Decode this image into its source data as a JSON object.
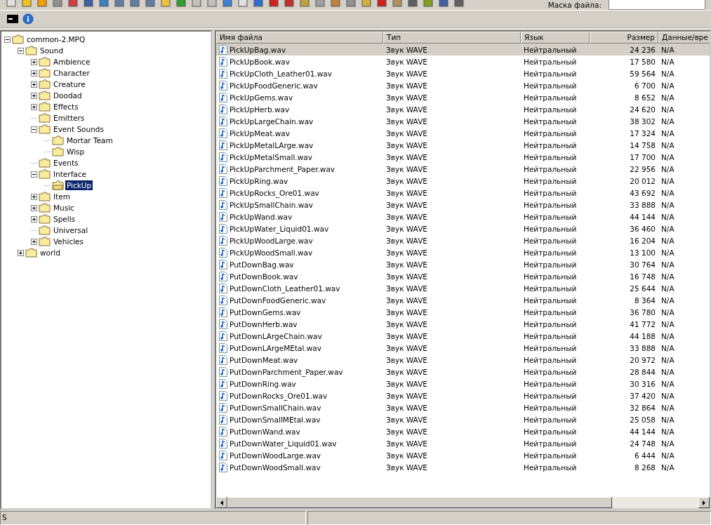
{
  "toolbar": {
    "mask_label": "Маска файла:"
  },
  "tree": [
    {
      "label": "common-2.MPQ",
      "expanded": true,
      "selected": false,
      "children": [
        {
          "label": "Sound",
          "expanded": true,
          "selected": false,
          "children": [
            {
              "label": "Ambience",
              "expanded": false,
              "selected": false
            },
            {
              "label": "Character",
              "expanded": false,
              "selected": false
            },
            {
              "label": "Creature",
              "expanded": false,
              "selected": false
            },
            {
              "label": "Doodad",
              "expanded": false,
              "selected": false
            },
            {
              "label": "Effects",
              "expanded": false,
              "selected": false
            },
            {
              "label": "Emitters",
              "selected": false
            },
            {
              "label": "Event Sounds",
              "expanded": true,
              "selected": false,
              "children": [
                {
                  "label": "Mortar Team",
                  "selected": false
                },
                {
                  "label": "Wisp",
                  "selected": false
                }
              ]
            },
            {
              "label": "Events",
              "selected": false
            },
            {
              "label": "Interface",
              "expanded": true,
              "selected": false,
              "children": [
                {
                  "label": "PickUp",
                  "selected": true
                }
              ]
            },
            {
              "label": "Item",
              "expanded": false,
              "selected": false
            },
            {
              "label": "Music",
              "expanded": false,
              "selected": false
            },
            {
              "label": "Spells",
              "expanded": false,
              "selected": false
            },
            {
              "label": "Universal",
              "selected": false
            },
            {
              "label": "Vehicles",
              "expanded": false,
              "selected": false
            }
          ]
        },
        {
          "label": "world",
          "expanded": false,
          "selected": false
        }
      ]
    }
  ],
  "table": {
    "columns": [
      "Имя файла",
      "Тип",
      "Язык",
      "Размер",
      "Данные/вре"
    ],
    "rows": [
      {
        "name": "PickUpBag.wav",
        "type": "Звук WAVE",
        "language": "Нейтральный",
        "size": "24 236",
        "data": "N/A",
        "selected": true
      },
      {
        "name": "PickUpBook.wav",
        "type": "Звук WAVE",
        "language": "Нейтральный",
        "size": "17 580",
        "data": "N/A",
        "selected": false
      },
      {
        "name": "PickUpCloth_Leather01.wav",
        "type": "Звук WAVE",
        "language": "Нейтральный",
        "size": "59 564",
        "data": "N/A",
        "selected": false
      },
      {
        "name": "PickUpFoodGeneric.wav",
        "type": "Звук WAVE",
        "language": "Нейтральный",
        "size": "6 700",
        "data": "N/A",
        "selected": false
      },
      {
        "name": "PickUpGems.wav",
        "type": "Звук WAVE",
        "language": "Нейтральный",
        "size": "8 652",
        "data": "N/A",
        "selected": false
      },
      {
        "name": "PickUpHerb.wav",
        "type": "Звук WAVE",
        "language": "Нейтральный",
        "size": "24 620",
        "data": "N/A",
        "selected": false
      },
      {
        "name": "PickUpLargeChain.wav",
        "type": "Звук WAVE",
        "language": "Нейтральный",
        "size": "38 302",
        "data": "N/A",
        "selected": false
      },
      {
        "name": "PickUpMeat.wav",
        "type": "Звук WAVE",
        "language": "Нейтральный",
        "size": "17 324",
        "data": "N/A",
        "selected": false
      },
      {
        "name": "PickUpMetalLArge.wav",
        "type": "Звук WAVE",
        "language": "Нейтральный",
        "size": "14 758",
        "data": "N/A",
        "selected": false
      },
      {
        "name": "PickUpMetalSmall.wav",
        "type": "Звук WAVE",
        "language": "Нейтральный",
        "size": "17 700",
        "data": "N/A",
        "selected": false
      },
      {
        "name": "PickUpParchment_Paper.wav",
        "type": "Звук WAVE",
        "language": "Нейтральный",
        "size": "22 956",
        "data": "N/A",
        "selected": false
      },
      {
        "name": "PickUpRing.wav",
        "type": "Звук WAVE",
        "language": "Нейтральный",
        "size": "20 012",
        "data": "N/A",
        "selected": false
      },
      {
        "name": "PickUpRocks_Ore01.wav",
        "type": "Звук WAVE",
        "language": "Нейтральный",
        "size": "43 692",
        "data": "N/A",
        "selected": false
      },
      {
        "name": "PickUpSmallChain.wav",
        "type": "Звук WAVE",
        "language": "Нейтральный",
        "size": "33 888",
        "data": "N/A",
        "selected": false
      },
      {
        "name": "PickUpWand.wav",
        "type": "Звук WAVE",
        "language": "Нейтральный",
        "size": "44 144",
        "data": "N/A",
        "selected": false
      },
      {
        "name": "PickUpWater_Liquid01.wav",
        "type": "Звук WAVE",
        "language": "Нейтральный",
        "size": "36 460",
        "data": "N/A",
        "selected": false
      },
      {
        "name": "PickUpWoodLarge.wav",
        "type": "Звук WAVE",
        "language": "Нейтральный",
        "size": "16 204",
        "data": "N/A",
        "selected": false
      },
      {
        "name": "PickUpWoodSmall.wav",
        "type": "Звук WAVE",
        "language": "Нейтральный",
        "size": "13 100",
        "data": "N/A",
        "selected": false
      },
      {
        "name": "PutDownBag.wav",
        "type": "Звук WAVE",
        "language": "Нейтральный",
        "size": "30 764",
        "data": "N/A",
        "selected": false
      },
      {
        "name": "PutDownBook.wav",
        "type": "Звук WAVE",
        "language": "Нейтральный",
        "size": "16 748",
        "data": "N/A",
        "selected": false
      },
      {
        "name": "PutDownCloth_Leather01.wav",
        "type": "Звук WAVE",
        "language": "Нейтральный",
        "size": "25 644",
        "data": "N/A",
        "selected": false
      },
      {
        "name": "PutDownFoodGeneric.wav",
        "type": "Звук WAVE",
        "language": "Нейтральный",
        "size": "8 364",
        "data": "N/A",
        "selected": false
      },
      {
        "name": "PutDownGems.wav",
        "type": "Звук WAVE",
        "language": "Нейтральный",
        "size": "36 780",
        "data": "N/A",
        "selected": false
      },
      {
        "name": "PutDownHerb.wav",
        "type": "Звук WAVE",
        "language": "Нейтральный",
        "size": "41 772",
        "data": "N/A",
        "selected": false
      },
      {
        "name": "PutDownLArgeChain.wav",
        "type": "Звук WAVE",
        "language": "Нейтральный",
        "size": "44 188",
        "data": "N/A",
        "selected": false
      },
      {
        "name": "PutDownLArgeMEtal.wav",
        "type": "Звук WAVE",
        "language": "Нейтральный",
        "size": "33 888",
        "data": "N/A",
        "selected": false
      },
      {
        "name": "PutDownMeat.wav",
        "type": "Звук WAVE",
        "language": "Нейтральный",
        "size": "20 972",
        "data": "N/A",
        "selected": false
      },
      {
        "name": "PutDownParchment_Paper.wav",
        "type": "Звук WAVE",
        "language": "Нейтральный",
        "size": "28 844",
        "data": "N/A",
        "selected": false
      },
      {
        "name": "PutDownRing.wav",
        "type": "Звук WAVE",
        "language": "Нейтральный",
        "size": "30 316",
        "data": "N/A",
        "selected": false
      },
      {
        "name": "PutDownRocks_Ore01.wav",
        "type": "Звук WAVE",
        "language": "Нейтральный",
        "size": "37 420",
        "data": "N/A",
        "selected": false
      },
      {
        "name": "PutDownSmallChain.wav",
        "type": "Звук WAVE",
        "language": "Нейтральный",
        "size": "32 864",
        "data": "N/A",
        "selected": false
      },
      {
        "name": "PutDownSmallMEtal.wav",
        "type": "Звук WAVE",
        "language": "Нейтральный",
        "size": "25 058",
        "data": "N/A",
        "selected": false
      },
      {
        "name": "PutDownWand.wav",
        "type": "Звук WAVE",
        "language": "Нейтральный",
        "size": "44 144",
        "data": "N/A",
        "selected": false
      },
      {
        "name": "PutDownWater_Liquid01.wav",
        "type": "Звук WAVE",
        "language": "Нейтральный",
        "size": "24 748",
        "data": "N/A",
        "selected": false
      },
      {
        "name": "PutDownWoodLarge.wav",
        "type": "Звук WAVE",
        "language": "Нейтральный",
        "size": "6 444",
        "data": "N/A",
        "selected": false
      },
      {
        "name": "PutDownWoodSmall.wav",
        "type": "Звук WAVE",
        "language": "Нейтральный",
        "size": "8 268",
        "data": "N/A",
        "selected": false
      }
    ]
  },
  "status_bar": {
    "left": "S"
  }
}
